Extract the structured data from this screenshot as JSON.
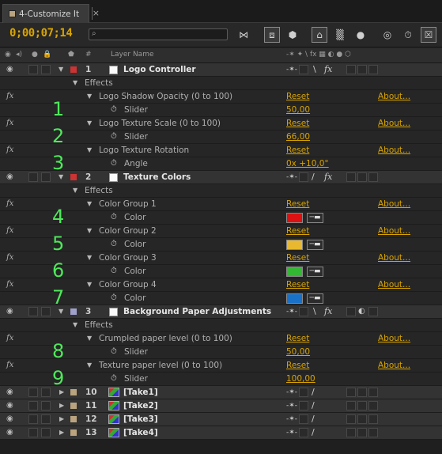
{
  "tab": {
    "label": "4-Customize It",
    "close": "×"
  },
  "toolbar": {
    "timecode": "0;00;07;14",
    "search_placeholder": ""
  },
  "columns": {
    "num": "#",
    "layer_name": "Layer Name"
  },
  "layers": [
    {
      "number": "1",
      "name": "Logo Controller",
      "label_color": "#cc3333"
    },
    {
      "number": "2",
      "name": "Texture Colors",
      "label_color": "#cc3333"
    },
    {
      "number": "3",
      "name": "Background Paper Adjustments",
      "label_color": "#a0a0cc"
    },
    {
      "number": "10",
      "name": "[Take1]",
      "label_color": "#b9a47f"
    },
    {
      "number": "11",
      "name": "[Take2]",
      "label_color": "#b9a47f"
    },
    {
      "number": "12",
      "name": "[Take3]",
      "label_color": "#b9a47f"
    },
    {
      "number": "13",
      "name": "[Take4]",
      "label_color": "#b9a47f"
    }
  ],
  "effects_label": "Effects",
  "reset_label": "Reset",
  "about_label": "About...",
  "fx_label": "fx",
  "effects": [
    {
      "name": "Logo Shadow Opacity (0 to 100)",
      "param": "Slider",
      "value": "50,00",
      "annotation": "1"
    },
    {
      "name": "Logo Texture Scale  (0 to 100)",
      "param": "Slider",
      "value": "66,00",
      "annotation": "2"
    },
    {
      "name": "Logo Texture Rotation",
      "param": "Angle",
      "value": "0x +10,0°",
      "annotation": "3"
    },
    {
      "name": "Color Group 1",
      "param": "Color",
      "color": "#dd1111",
      "annotation": "4"
    },
    {
      "name": "Color Group 2",
      "param": "Color",
      "color": "#e8b830",
      "annotation": "5"
    },
    {
      "name": "Color Group 3",
      "param": "Color",
      "color": "#33b833",
      "annotation": "6"
    },
    {
      "name": "Color Group 4",
      "param": "Color",
      "color": "#1a72c8",
      "annotation": "7"
    },
    {
      "name": "Crumpled paper level (0 to 100)",
      "param": "Slider",
      "value": "50,00",
      "annotation": "8"
    },
    {
      "name": "Texture paper level (0 to 100)",
      "param": "Slider",
      "value": "100,00",
      "annotation": "9"
    }
  ]
}
